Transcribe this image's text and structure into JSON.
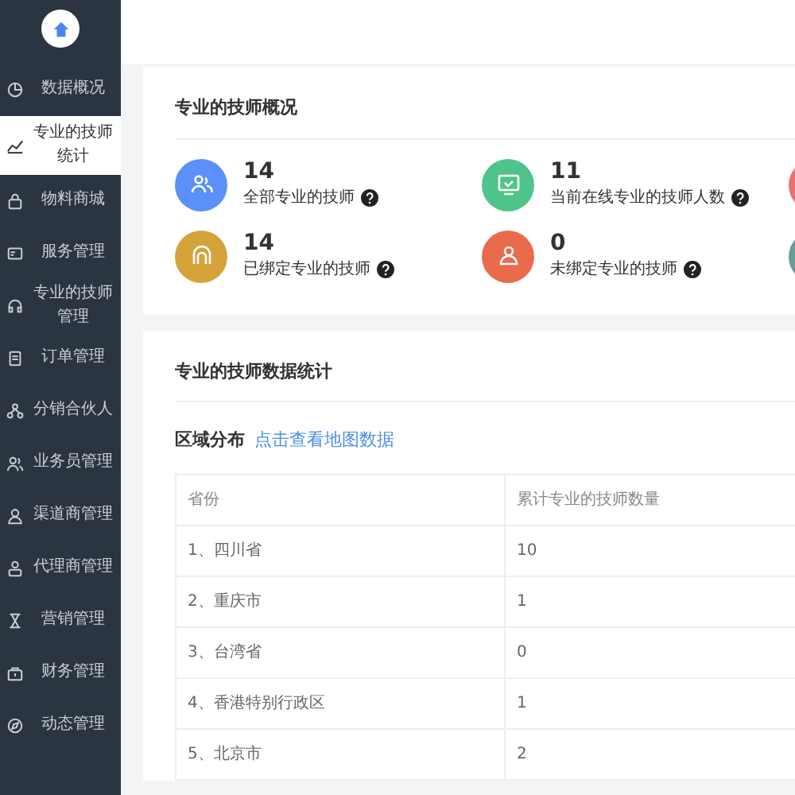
{
  "sidebar": {
    "items": [
      {
        "label": "数据概况",
        "selected": false
      },
      {
        "label": "专业的技师统计",
        "selected": true
      },
      {
        "label": "物料商城",
        "selected": false
      },
      {
        "label": "服务管理",
        "selected": false
      },
      {
        "label": "专业的技师管理",
        "selected": false
      },
      {
        "label": "订单管理",
        "selected": false
      },
      {
        "label": "分销合伙人",
        "selected": false
      },
      {
        "label": "业务员管理",
        "selected": false
      },
      {
        "label": "渠道商管理",
        "selected": false
      },
      {
        "label": "代理商管理",
        "selected": false
      },
      {
        "label": "营销管理",
        "selected": false
      },
      {
        "label": "财务管理",
        "selected": false
      },
      {
        "label": "动态管理",
        "selected": false
      }
    ]
  },
  "overview": {
    "title": "专业的技师概况",
    "stats": [
      {
        "value": "14",
        "label": "全部专业的技师",
        "color": "#5b8ff9"
      },
      {
        "value": "11",
        "label": "当前在线专业的技师人数",
        "color": "#4fc48a"
      },
      {
        "color": "#e8736d"
      },
      {
        "value": "14",
        "label": "已绑定专业的技师",
        "color": "#d4a43a"
      },
      {
        "value": "0",
        "label": "未绑定专业的技师",
        "color": "#ea6a4c"
      },
      {
        "color": "#6a9a9c"
      }
    ]
  },
  "statistics": {
    "title": "专业的技师数据统计",
    "section": "区域分布",
    "link": "点击查看地图数据",
    "table": {
      "columns": [
        "省份",
        "累计专业的技师数量"
      ],
      "rows": [
        [
          "1、四川省",
          "10"
        ],
        [
          "2、重庆市",
          "1"
        ],
        [
          "3、台湾省",
          "0"
        ],
        [
          "4、香港特别行政区",
          "1"
        ],
        [
          "5、北京市",
          "2"
        ]
      ]
    }
  }
}
